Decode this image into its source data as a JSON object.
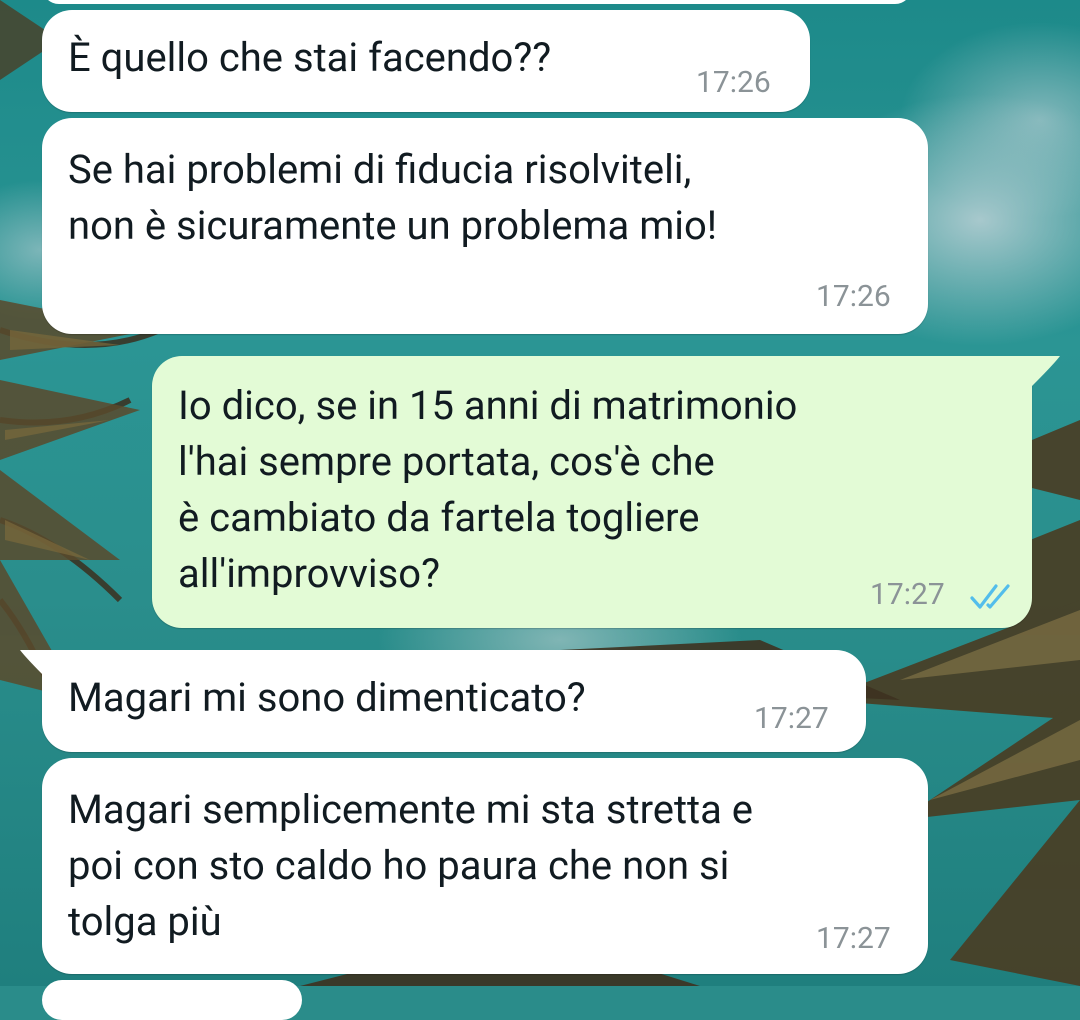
{
  "messages": [
    {
      "direction": "in",
      "text": "È quello che stai facendo??",
      "time": "17:26"
    },
    {
      "direction": "in",
      "text": "Se hai problemi di fiducia risolviteli,\nnon è sicuramente un problema mio!",
      "time": "17:26"
    },
    {
      "direction": "out",
      "text": "Io dico, se in 15 anni di matrimonio\nl'hai sempre portata, cos'è che\nè cambiato da fartela togliere\nall'improvviso?",
      "time": "17:27",
      "status": "read"
    },
    {
      "direction": "in",
      "text": "Magari mi sono dimenticato?",
      "time": "17:27"
    },
    {
      "direction": "in",
      "text": "Magari semplicemente mi sta stretta e\npoi con sto caldo ho paura che non si\ntolga più",
      "time": "17:27"
    }
  ],
  "colors": {
    "incoming_bubble": "#ffffff",
    "outgoing_bubble": "#e3fbd6",
    "timestamp": "#8b9397",
    "read_ticks": "#53bdeb",
    "wallpaper": "#2a8e8c"
  },
  "icons": {
    "read_receipt": "double-check-icon"
  }
}
